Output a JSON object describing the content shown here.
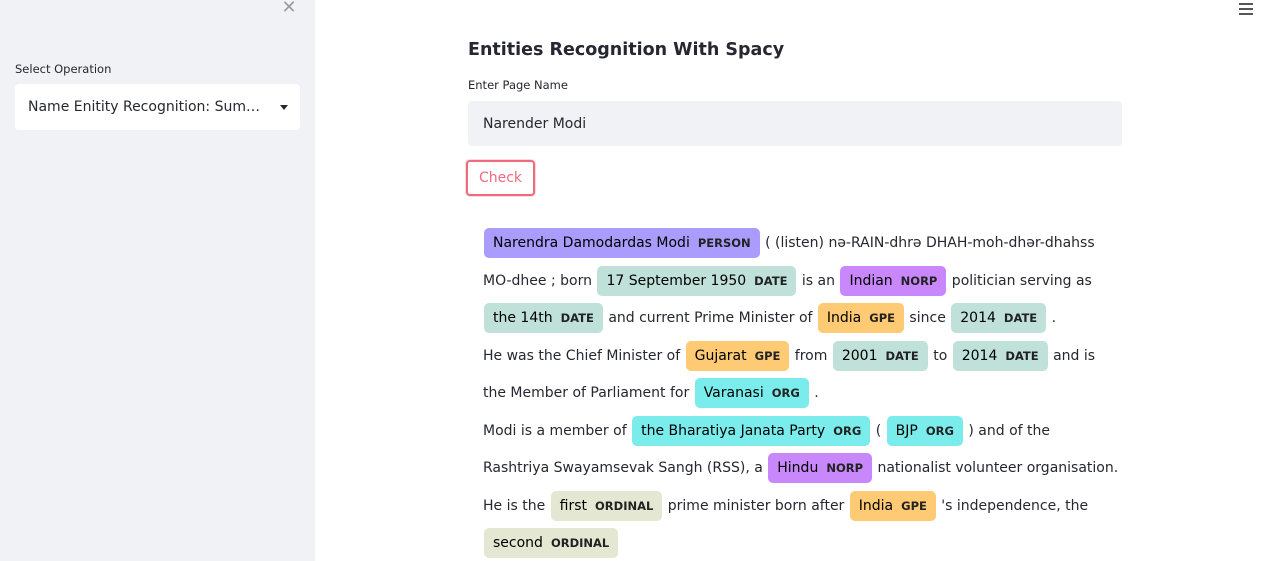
{
  "sidebar": {
    "close_icon": "close-icon",
    "select_label": "Select Operation",
    "select_value": "Name Enitity Recognition: Summ..."
  },
  "header": {
    "menu_icon": "hamburger-icon"
  },
  "main": {
    "title": "Entities Recognition With Spacy",
    "input_label": "Enter Page Name",
    "input_value": "Narender Modi",
    "check_label": "Check"
  },
  "colors": {
    "PERSON": "#aa9cfc",
    "DATE": "#bfe1d9",
    "NORP": "#c887fb",
    "GPE": "#feca74",
    "ORG": "#7aecec",
    "ORDINAL": "#e4e7d2",
    "button_accent": "#f06a7d"
  },
  "entities": {
    "lines": [
      [
        {
          "type": "ent",
          "text": "Narendra Damodardas Modi",
          "label": "PERSON"
        },
        {
          "type": "text",
          "text": " ( (listen) nə-RAIN-dhrə DHAH-moh-dhər-dhahss"
        }
      ],
      [
        {
          "type": "text",
          "text": "MO-dhee ; born "
        },
        {
          "type": "ent",
          "text": "17 September 1950",
          "label": "DATE"
        },
        {
          "type": "text",
          "text": " is an "
        },
        {
          "type": "ent",
          "text": "Indian",
          "label": "NORP"
        },
        {
          "type": "text",
          "text": " politician serving as"
        }
      ],
      [
        {
          "type": "ent",
          "text": "the 14th",
          "label": "DATE"
        },
        {
          "type": "text",
          "text": " and current Prime Minister of "
        },
        {
          "type": "ent",
          "text": "India",
          "label": "GPE"
        },
        {
          "type": "text",
          "text": " since "
        },
        {
          "type": "ent",
          "text": "2014",
          "label": "DATE"
        },
        {
          "type": "text",
          "text": " ."
        }
      ],
      [
        {
          "type": "text",
          "text": "He was the Chief Minister of "
        },
        {
          "type": "ent",
          "text": "Gujarat",
          "label": "GPE"
        },
        {
          "type": "text",
          "text": " from "
        },
        {
          "type": "ent",
          "text": "2001",
          "label": "DATE"
        },
        {
          "type": "text",
          "text": " to "
        },
        {
          "type": "ent",
          "text": "2014",
          "label": "DATE"
        },
        {
          "type": "text",
          "text": " and is"
        }
      ],
      [
        {
          "type": "text",
          "text": "the Member of Parliament for "
        },
        {
          "type": "ent",
          "text": "Varanasi",
          "label": "ORG"
        },
        {
          "type": "text",
          "text": " ."
        }
      ],
      [
        {
          "type": "text",
          "text": "Modi is a member of "
        },
        {
          "type": "ent",
          "text": "the Bharatiya Janata Party",
          "label": "ORG"
        },
        {
          "type": "text",
          "text": " ( "
        },
        {
          "type": "ent",
          "text": "BJP",
          "label": "ORG"
        },
        {
          "type": "text",
          "text": " ) and of the"
        }
      ],
      [
        {
          "type": "text",
          "text": "Rashtriya Swayamsevak Sangh (RSS), a "
        },
        {
          "type": "ent",
          "text": "Hindu",
          "label": "NORP"
        },
        {
          "type": "text",
          "text": " nationalist volunteer organisation."
        }
      ],
      [
        {
          "type": "text",
          "text": "He is the "
        },
        {
          "type": "ent",
          "text": "first",
          "label": "ORDINAL"
        },
        {
          "type": "text",
          "text": " prime minister born after "
        },
        {
          "type": "ent",
          "text": "India",
          "label": "GPE"
        },
        {
          "type": "text",
          "text": " 's independence, the"
        }
      ],
      [
        {
          "type": "ent",
          "text": "second",
          "label": "ORDINAL"
        }
      ]
    ]
  }
}
